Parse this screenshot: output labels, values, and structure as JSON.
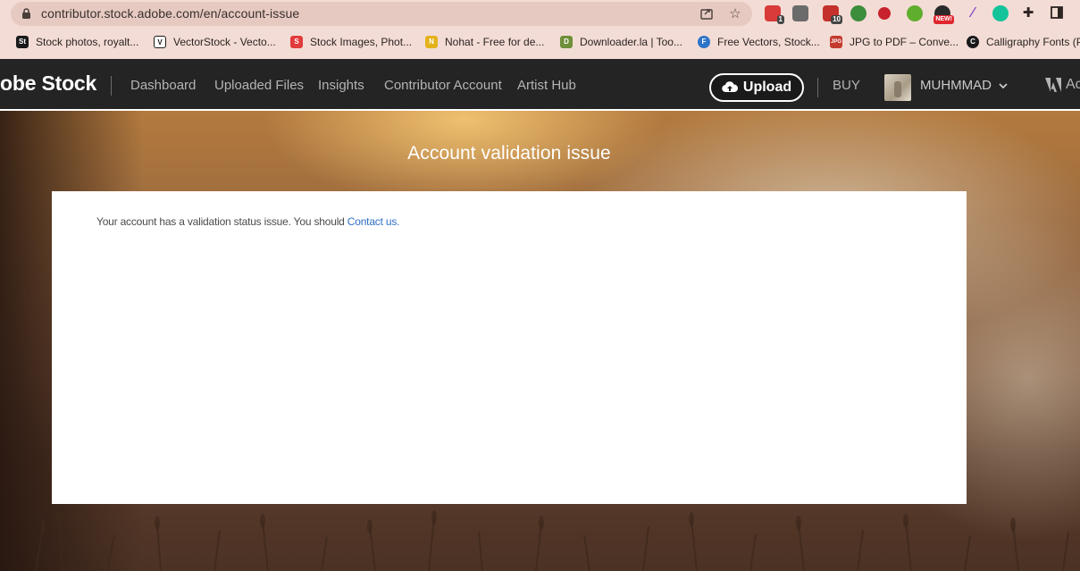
{
  "browser": {
    "url": "contributor.stock.adobe.com/en/account-issue",
    "extensions": [
      {
        "name": "abbyy-extension",
        "badge": "1",
        "color": "#d93a3a"
      },
      {
        "name": "tube-extension",
        "badge": "",
        "color": "#6b6b6b"
      },
      {
        "name": "abp-extension",
        "badge": "10",
        "color": "#c4302b"
      },
      {
        "name": "globe-extension",
        "badge": "",
        "color": "#3c8d3c"
      },
      {
        "name": "pinterest-extension",
        "badge": "",
        "color": "#c8232c"
      },
      {
        "name": "bulb-extension",
        "badge": "",
        "color": "#5fae2e"
      },
      {
        "name": "new-extension",
        "badge": "NEW!",
        "color": "#2a2a2a"
      },
      {
        "name": "feather-extension",
        "badge": "",
        "color": "#8a4fd0"
      },
      {
        "name": "grammarly-extension",
        "badge": "",
        "color": "#15c39a"
      }
    ],
    "bookmarks": [
      {
        "label": "Stock photos, royalt...",
        "icon": "St",
        "color": "#1a1a1a"
      },
      {
        "label": "VectorStock - Vecto...",
        "icon": "V",
        "color": "#1a1a1a"
      },
      {
        "label": "Stock Images, Phot...",
        "icon": "S",
        "color": "#e23b3b"
      },
      {
        "label": "Nohat - Free for de...",
        "icon": "N",
        "color": "#e3b21b"
      },
      {
        "label": "Downloader.la | Too...",
        "icon": "D",
        "color": "#6f8f3a"
      },
      {
        "label": "Free Vectors, Stock...",
        "icon": "F",
        "color": "#2e74c8"
      },
      {
        "label": "JPG to PDF – Conve...",
        "icon": "JPG",
        "color": "#c33a2f"
      },
      {
        "label": "Calligraphy Fonts (P",
        "icon": "C",
        "color": "#1a1a1a"
      }
    ]
  },
  "nav": {
    "brand": "obe Stock",
    "links": [
      "Dashboard",
      "Uploaded Files",
      "Insights",
      "Contributor Account",
      "Artist Hub"
    ],
    "upload_label": "Upload",
    "buy_label": "BUY",
    "username": "MUHMMAD",
    "adobe_label": "Ac"
  },
  "page": {
    "title": "Account validation issue",
    "message_prefix": "Your account has a validation status issue. You should ",
    "contact_link": "Contact us."
  },
  "colors": {
    "nav_bg": "#242424",
    "link_blue": "#2f6fc4",
    "chrome_bg": "#f3dcd5"
  }
}
